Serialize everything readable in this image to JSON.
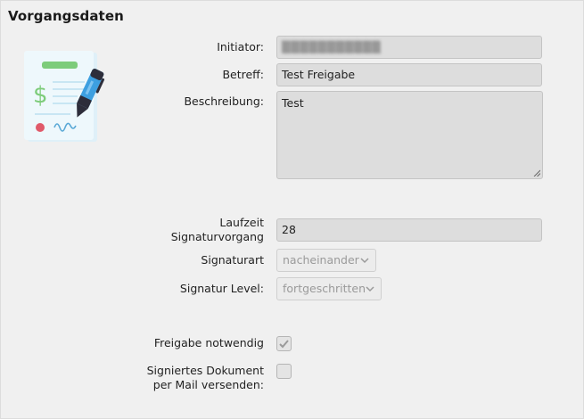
{
  "section": {
    "title": "Vorgangsdaten"
  },
  "fields": {
    "initiator": {
      "label": "Initiator:",
      "value": "▒▒▒▒▒▒▒▒▒▒▒"
    },
    "betreff": {
      "label": "Betreff:",
      "value": "Test Freigabe"
    },
    "beschreibung": {
      "label": "Beschreibung:",
      "value": "Test"
    },
    "laufzeit": {
      "label_line1": "Laufzeit",
      "label_line2": "Signaturvorgang",
      "value": "28"
    },
    "signaturart": {
      "label": "Signaturart",
      "selected": "nacheinander"
    },
    "signatur_level": {
      "label": "Signatur Level:",
      "selected": "fortgeschritten"
    },
    "freigabe": {
      "label": "Freigabe notwendig",
      "checked": true
    },
    "signiertes_dokument": {
      "label_line1": "Signiertes Dokument",
      "label_line2": "per Mail versenden:",
      "checked": false
    }
  },
  "icons": {
    "illustration": "signed-contract-icon",
    "dropdown": "chevron-down-icon",
    "check": "check-icon",
    "resize": "resize-grip-icon"
  },
  "colors": {
    "background": "#f0f0f0",
    "field_bg": "#dddddd",
    "disabled_text": "#9a9a9a",
    "accent_green": "#7dcc7a",
    "pen_blue": "#3d9fe0",
    "stamp_red": "#e05a6a"
  }
}
